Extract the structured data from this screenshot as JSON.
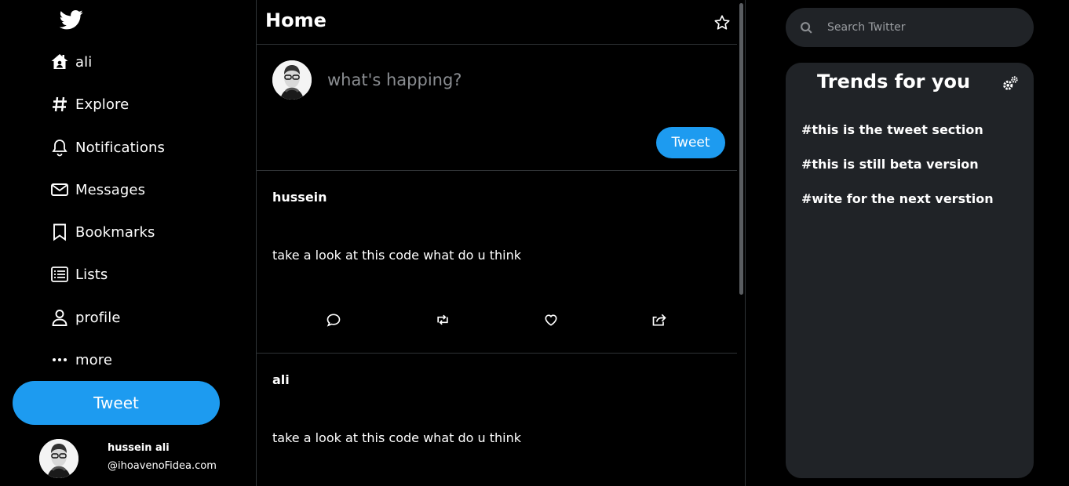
{
  "sidebar": {
    "items": [
      {
        "icon": "home-icon",
        "label": "ali"
      },
      {
        "icon": "hashtag-icon",
        "label": "Explore"
      },
      {
        "icon": "bell-icon",
        "label": "Notifications"
      },
      {
        "icon": "envelope-icon",
        "label": "Messages"
      },
      {
        "icon": "bookmark-icon",
        "label": "Bookmarks"
      },
      {
        "icon": "list-icon",
        "label": "Lists"
      },
      {
        "icon": "user-icon",
        "label": "profile"
      },
      {
        "icon": "ellipsis-icon",
        "label": "more"
      }
    ],
    "tweet_label": "Tweet",
    "account": {
      "name": "hussein ali",
      "handle": "@ihoavenoFidea.com"
    }
  },
  "feed": {
    "title": "Home",
    "compose": {
      "placeholder": "what's happing?",
      "tweet_label": "Tweet"
    },
    "posts": [
      {
        "author": "hussein",
        "text": "take a look at this code what do u think"
      },
      {
        "author": "ali",
        "text": "take a look at this code what do u think"
      }
    ]
  },
  "right": {
    "search_placeholder": "Search Twitter",
    "trends_title": "Trends for you",
    "trends": [
      "#this is the tweet section",
      "#this is still beta version",
      "#wite for the next verstion"
    ]
  },
  "colors": {
    "accent": "#1d9bf0",
    "panel": "#202327",
    "background": "#000000"
  }
}
